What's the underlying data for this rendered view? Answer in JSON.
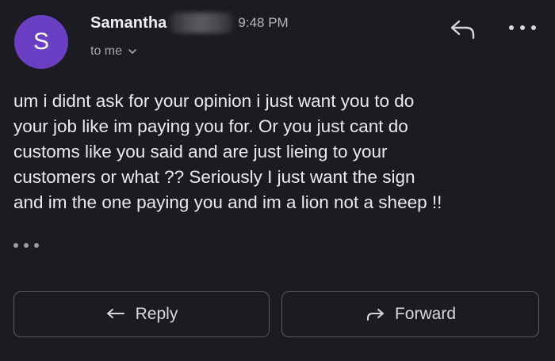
{
  "sender": {
    "avatar_letter": "S",
    "avatar_color": "#6a3fc4",
    "name": "Samantha",
    "time": "9:48 PM",
    "recipient": "to me"
  },
  "header_actions": {
    "reply_icon": "reply-arrow-icon",
    "more_icon": "more-horizontal-icon"
  },
  "message": {
    "body": "um i didnt ask for your opinion i just want you to do\nyour job like im paying you for. Or you just cant do\ncustoms like you said and are just lieing to your\ncustomers or what ?? Seriously I just want the sign\nand im the one paying you and im a lion not a sheep !!"
  },
  "actions": {
    "reply_label": "Reply",
    "forward_label": "Forward"
  }
}
